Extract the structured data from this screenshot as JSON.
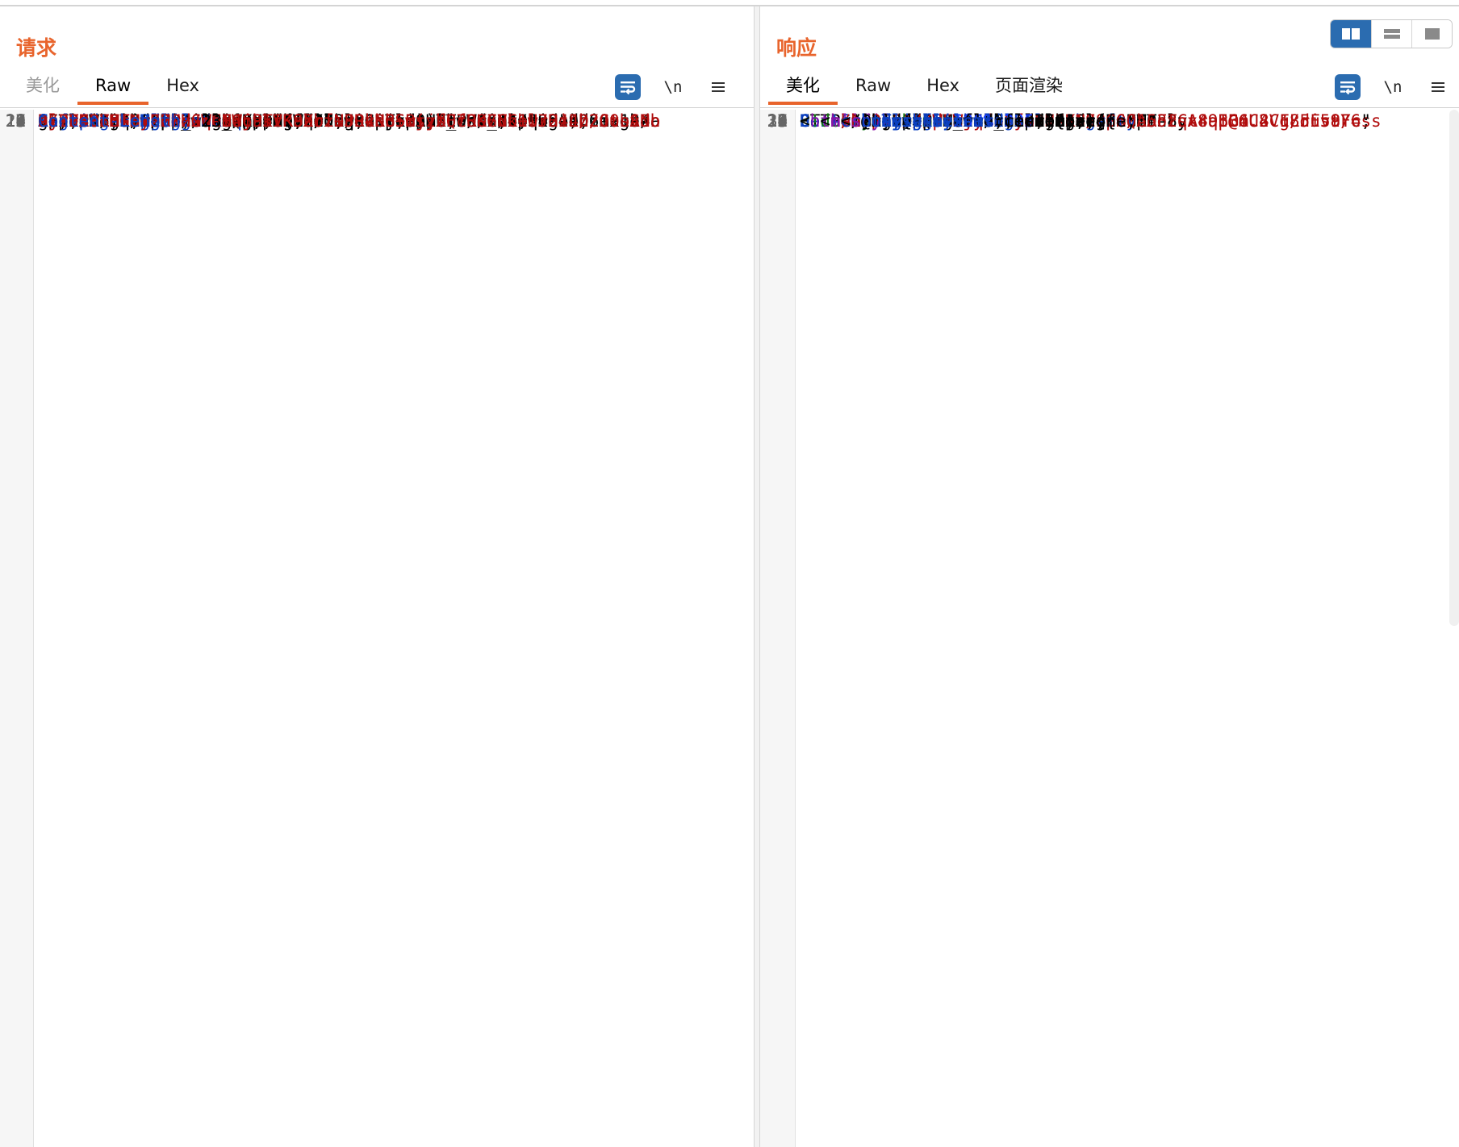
{
  "layout_toggle": {
    "options": [
      "split-horizontal",
      "split-vertical",
      "single-pane"
    ],
    "active_index": 0
  },
  "request": {
    "title": "请求",
    "tabs": [
      {
        "label": "美化",
        "state": "muted"
      },
      {
        "label": "Raw",
        "state": "active"
      },
      {
        "label": "Hex",
        "state": "normal"
      }
    ],
    "tools": {
      "newline_label": "\\n"
    },
    "lines": [
      {
        "n": "1",
        "segs": [
          [
            "GET /shirodemo_war_exploded/login.jsp HTTP/1.1",
            ""
          ]
        ]
      },
      {
        "n": "2",
        "segs": [
          [
            "Host",
            "k"
          ],
          [
            ": 127.0.0.1:8070",
            ""
          ]
        ]
      },
      {
        "n": "3",
        "segs": [
          [
            "Cache-Control",
            "k"
          ],
          [
            ": max-age=0",
            ""
          ]
        ]
      },
      {
        "n": "4",
        "segs": [
          [
            "Upgrade-Insecure-Requests",
            "k"
          ],
          [
            ": 1",
            ""
          ]
        ]
      },
      {
        "n": "5",
        "segs": [
          [
            "User-Agent",
            "k"
          ],
          [
            ": Mozilla/5.0 (Windows NT 10.0; Win64; x64)",
            ""
          ]
        ]
      },
      {
        "n": "",
        "segs": [
          [
            "AppleWebKit/537.36 (KHTML, like Gecko) Chrome/103.0.5060.134",
            ""
          ]
        ]
      },
      {
        "n": "",
        "segs": [
          [
            "Safari/537.36",
            ""
          ]
        ]
      },
      {
        "n": "6",
        "segs": [
          [
            "Accept",
            "k"
          ],
          [
            ":",
            ""
          ]
        ]
      },
      {
        "n": "",
        "segs": [
          [
            "text/html,application/xhtml+xml,application/xml;q=0.9,image/a",
            ""
          ]
        ]
      },
      {
        "n": "",
        "segs": [
          [
            "vif,image/webp,image/apng,*/*;q=0.8,application/signed-exchan",
            ""
          ]
        ]
      },
      {
        "n": "",
        "segs": [
          [
            "ge;v=b3;q=0.9",
            ""
          ]
        ]
      },
      {
        "n": "7",
        "segs": [
          [
            "Sec-Fetch-Site",
            "k"
          ],
          [
            ": same-origin",
            ""
          ]
        ]
      },
      {
        "n": "8",
        "segs": [
          [
            "Sec-Fetch-Mode",
            "k"
          ],
          [
            ": navigate",
            ""
          ]
        ]
      },
      {
        "n": "9",
        "segs": [
          [
            "Sec-Fetch-User",
            "k"
          ],
          [
            ": ?1",
            ""
          ]
        ]
      },
      {
        "n": "10",
        "segs": [
          [
            "Sec-Fetch-Dest",
            "k"
          ],
          [
            ": document",
            ""
          ]
        ]
      },
      {
        "n": "11",
        "segs": [
          [
            "sec-ch-ua",
            "k"
          ],
          [
            ": \"Chromium\";v=\"103\", \".Not/A)Brand\";v=\"99\"",
            ""
          ]
        ]
      },
      {
        "n": "12",
        "segs": [
          [
            "sec-ch-ua-mobile",
            "k"
          ],
          [
            ": ?0",
            ""
          ]
        ]
      },
      {
        "n": "13",
        "segs": [
          [
            "sec-ch-ua-platform",
            "k"
          ],
          [
            ": \"macOS\"",
            ""
          ]
        ]
      },
      {
        "n": "14",
        "segs": [
          [
            "Referer",
            "k"
          ],
          [
            ": http://127.0.0.1:8070/shirodemo_war_exploded/",
            ""
          ]
        ]
      },
      {
        "n": "15",
        "segs": [
          [
            "Accept-Encoding",
            "k"
          ],
          [
            ": gzip, deflate",
            ""
          ]
        ]
      },
      {
        "n": "16",
        "segs": [
          [
            "Accept-Language",
            "k"
          ],
          [
            ": zh-CN,zh;q=0.9",
            ""
          ]
        ]
      },
      {
        "n": "17",
        "segs": [
          [
            "Cookie",
            "k"
          ],
          [
            ": ",
            ""
          ],
          [
            "rememberMe",
            "k"
          ],
          [
            "=",
            ""
          ]
        ]
      },
      {
        "n": "",
        "segs": [
          [
            "DlP2APBZTM+zHrHGWHNGjhkrKS2oiU5RvRBSmtzbU7OeGVb1lr2zJ/2CobAdo",
            "r"
          ]
        ]
      },
      {
        "n": "",
        "segs": [
          [
            "zb795BYnGtxDZNzJqCt469TVKobrf+JP4NG5wsyfQcHKFNk+U734Lh2O0svDn",
            "r"
          ]
        ]
      },
      {
        "n": "",
        "segs": [
          [
            "s/5PNuZ6tayE2PdxWe8WcP5IR9XbzNPOkbb+BjjXFfR076CbwJHi4D/JtnSNb",
            "r"
          ]
        ]
      },
      {
        "n": "",
        "segs": [
          [
            "GjsTGcZMs",
            "r"
          ]
        ],
        "hl": true
      },
      {
        "n": "18",
        "segs": [
          [
            "Content-Length",
            "k"
          ],
          [
            ": 23",
            ""
          ]
        ]
      },
      {
        "n": "19",
        "segs": [
          [
            "",
            ""
          ]
        ]
      },
      {
        "n": "20",
        "segs": [
          [
            "Content-Length:",
            "k"
          ],
          [
            " 2",
            ""
          ]
        ]
      },
      {
        "n": "21",
        "segs": [
          [
            "",
            ""
          ]
        ]
      },
      {
        "n": "22",
        "segs": [
          [
            "",
            ""
          ]
        ]
      },
      {
        "n": "23",
        "segs": [
          [
            "",
            ""
          ]
        ]
      }
    ]
  },
  "response": {
    "title": "响应",
    "tabs": [
      {
        "label": "美化",
        "state": "active"
      },
      {
        "label": "Raw",
        "state": "normal"
      },
      {
        "label": "Hex",
        "state": "normal"
      },
      {
        "label": "页面渲染",
        "state": "normal"
      }
    ],
    "tools": {
      "newline_label": "\\n"
    },
    "lines": [
      {
        "n": "1",
        "segs": [
          [
            "HTTP/1.1 200",
            ""
          ]
        ],
        "hl": true
      },
      {
        "n": "2",
        "segs": [
          [
            "Set-Cookie",
            "k"
          ],
          [
            ": ",
            ""
          ],
          [
            "JSESSIONID",
            "k"
          ],
          [
            "=",
            ""
          ],
          [
            "06838E8806CA3FCA89BB6C8CF85F58F6",
            "r"
          ],
          [
            ";",
            ""
          ]
        ]
      },
      {
        "n": "",
        "segs": [
          [
            "Path=/shirodemo_war_exploded; HttpOnly",
            ""
          ]
        ]
      },
      {
        "n": "3",
        "segs": [
          [
            "Content-Type",
            "k"
          ],
          [
            ": text/html;charset=UTF-8",
            ""
          ]
        ]
      },
      {
        "n": "4",
        "segs": [
          [
            "Content-Length",
            "k"
          ],
          [
            ": 2546",
            ""
          ]
        ]
      },
      {
        "n": "5",
        "segs": [
          [
            "Date",
            "k"
          ],
          [
            ": Fri, 15 Mar 2024 17:15:47 GMT",
            ""
          ]
        ]
      },
      {
        "n": "6",
        "segs": [
          [
            "",
            ""
          ]
        ]
      },
      {
        "n": "7",
        "segs": [
          [
            "",
            ""
          ]
        ]
      },
      {
        "n": "8",
        "segs": [
          [
            "<!doctype html>",
            "g"
          ]
        ]
      },
      {
        "n": "9",
        "segs": [
          [
            "<",
            ""
          ],
          [
            "html",
            "p"
          ],
          [
            " ",
            ""
          ],
          [
            "lang",
            "k"
          ],
          [
            "=\"",
            ""
          ],
          [
            "en",
            "r"
          ],
          [
            "\">",
            ""
          ]
        ]
      },
      {
        "n": "10",
        "segs": [
          [
            "  <",
            ""
          ],
          [
            "head",
            "p"
          ],
          [
            ">",
            ""
          ]
        ]
      },
      {
        "n": "11",
        "segs": [
          [
            "    <",
            ""
          ],
          [
            "meta",
            "p"
          ],
          [
            " ",
            ""
          ],
          [
            "charset",
            "k"
          ],
          [
            "=\"",
            ""
          ],
          [
            "utf-8",
            "r"
          ],
          [
            "\">",
            ""
          ]
        ]
      },
      {
        "n": "12",
        "segs": [
          [
            "    <",
            ""
          ],
          [
            "title",
            "p"
          ],
          [
            ">",
            ""
          ]
        ]
      },
      {
        "n": "",
        "segs": [
          [
            "      Login Page",
            ""
          ]
        ]
      },
      {
        "n": "",
        "segs": [
          [
            "    </",
            ""
          ],
          [
            "title",
            "p"
          ],
          [
            ">",
            ""
          ]
        ]
      },
      {
        "n": "13",
        "segs": [
          [
            "    <",
            ""
          ],
          [
            "link",
            "p"
          ],
          [
            " ",
            ""
          ],
          [
            "rel",
            "k"
          ],
          [
            "=\"",
            ""
          ],
          [
            "stylesheet",
            "r"
          ],
          [
            "\" ",
            ""
          ],
          [
            "href",
            "k"
          ],
          [
            "=\"",
            ""
          ]
        ]
      },
      {
        "n": "",
        "segs": [
          [
            "    https://cdn.jsdelivr.net/npm/bootstrap@4.4.1/dist/css",
            "r"
          ]
        ]
      },
      {
        "n": "",
        "segs": [
          [
            "    /bootstrap.min.css",
            "r"
          ],
          [
            "\" ",
            ""
          ],
          [
            "integrity",
            "k"
          ],
          [
            "=\"",
            ""
          ]
        ]
      },
      {
        "n": "",
        "segs": [
          [
            "    sha256-L/W5Wfqfa0sdBNIKN9cG6QA5F2qx4qICmU2VgLruv9Y=",
            "r"
          ],
          [
            "\"",
            ""
          ]
        ]
      },
      {
        "n": "",
        "segs": [
          [
            "    ",
            ""
          ],
          [
            "crossorigin",
            "k"
          ],
          [
            "=\"",
            ""
          ],
          [
            "anonymous",
            "r"
          ],
          [
            "\">",
            ""
          ]
        ]
      },
      {
        "n": "14",
        "segs": [
          [
            "    <",
            ""
          ],
          [
            "style",
            "p"
          ],
          [
            ">",
            ""
          ]
        ]
      },
      {
        "n": "15",
        "segs": [
          [
            "      .bd-placeholder-img{",
            ""
          ]
        ]
      },
      {
        "n": "16",
        "segs": [
          [
            "        ",
            ""
          ],
          [
            "font-size",
            "k"
          ],
          [
            ":",
            ""
          ],
          [
            "1.125",
            "n"
          ],
          [
            "rem;",
            ""
          ]
        ]
      },
      {
        "n": "17",
        "segs": [
          [
            "        ",
            ""
          ],
          [
            "text-anchor",
            "k"
          ],
          [
            ":middle;",
            ""
          ]
        ]
      },
      {
        "n": "18",
        "segs": [
          [
            "        ",
            ""
          ],
          [
            "-webkit-user-select",
            "k"
          ],
          [
            ":none;",
            ""
          ]
        ]
      },
      {
        "n": "19",
        "segs": [
          [
            "        ",
            ""
          ],
          [
            "-moz-user-select",
            "k"
          ],
          [
            ":none;",
            ""
          ]
        ]
      },
      {
        "n": "20",
        "segs": [
          [
            "        ",
            ""
          ],
          [
            "-ms-user-select",
            "k"
          ],
          [
            ":none;",
            ""
          ]
        ]
      },
      {
        "n": "21",
        "segs": [
          [
            "        ",
            ""
          ],
          [
            "user-select",
            "k"
          ],
          [
            ":none;",
            ""
          ]
        ]
      },
      {
        "n": "22",
        "segs": [
          [
            "      }",
            ""
          ]
        ]
      },
      {
        "n": "23",
        "segs": [
          [
            "",
            ""
          ]
        ]
      },
      {
        "n": "24",
        "segs": [
          [
            "      @media(",
            ""
          ],
          [
            "min-width",
            "k"
          ],
          [
            ":768px){",
            ""
          ]
        ]
      },
      {
        "n": "25",
        "segs": [
          [
            "        .bd-placeholder-img-lg{",
            ""
          ]
        ]
      },
      {
        "n": "26",
        "segs": [
          [
            "          ",
            ""
          ],
          [
            "font-size",
            "k"
          ],
          [
            ":",
            ""
          ],
          [
            "3.5",
            "n"
          ],
          [
            "rem;",
            ""
          ]
        ]
      },
      {
        "n": "27",
        "segs": [
          [
            "        }",
            ""
          ]
        ]
      },
      {
        "n": "28",
        "segs": [
          [
            "      }",
            ""
          ]
        ]
      },
      {
        "n": "29",
        "segs": [
          [
            "",
            ""
          ]
        ]
      },
      {
        "n": "30",
        "segs": [
          [
            "      ",
            ""
          ],
          [
            "html",
            "k"
          ],
          [
            ",",
            ""
          ]
        ]
      },
      {
        "n": "31",
        "segs": [
          [
            "      ",
            ""
          ],
          [
            "body",
            "k"
          ],
          [
            "{",
            ""
          ]
        ]
      },
      {
        "n": "32",
        "segs": [
          [
            "        ",
            ""
          ],
          [
            "height",
            "k"
          ],
          [
            ":",
            ""
          ],
          [
            "100%",
            "n"
          ],
          [
            ";",
            ""
          ]
        ]
      },
      {
        "n": "33",
        "segs": [
          [
            "      }",
            ""
          ]
        ]
      },
      {
        "n": "34",
        "segs": [
          [
            "",
            ""
          ]
        ]
      },
      {
        "n": "35",
        "segs": [
          [
            "      ",
            ""
          ],
          [
            "body",
            "k"
          ],
          [
            "{",
            ""
          ]
        ]
      },
      {
        "n": "36",
        "segs": [
          [
            "        ",
            ""
          ],
          [
            "display",
            "k"
          ],
          [
            ":-ms-flexbox;",
            ""
          ]
        ]
      },
      {
        "n": "37",
        "segs": [
          [
            "        ",
            ""
          ],
          [
            "display",
            "k"
          ],
          [
            ":flex;",
            ""
          ]
        ]
      },
      {
        "n": "38",
        "segs": [
          [
            "        ",
            ""
          ],
          [
            "-ms-flex-align",
            "k"
          ],
          [
            ":center;",
            ""
          ]
        ]
      },
      {
        "n": "39",
        "segs": [
          [
            "        ",
            ""
          ],
          [
            "align-items",
            "k"
          ],
          [
            ":center;",
            ""
          ]
        ]
      }
    ]
  }
}
